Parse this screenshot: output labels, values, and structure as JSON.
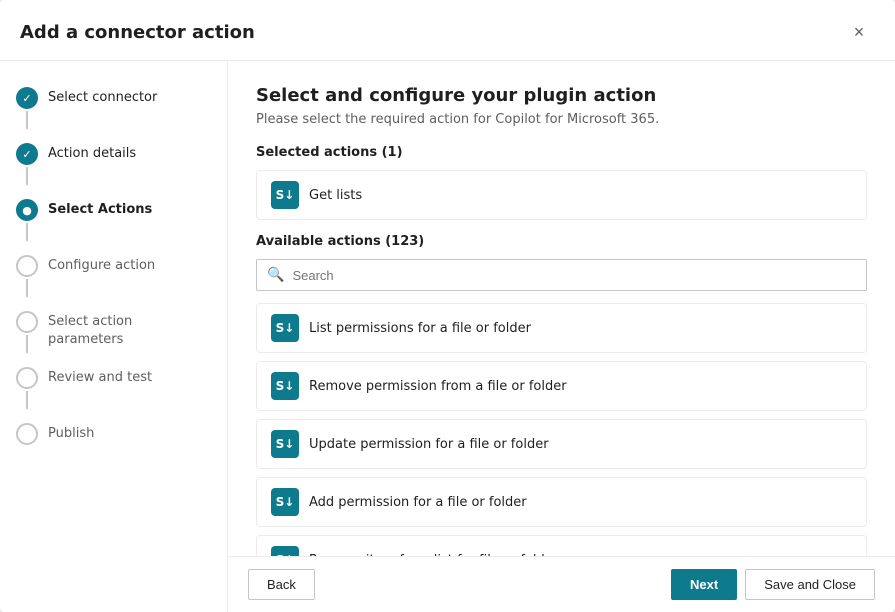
{
  "modal": {
    "title": "Add a connector action",
    "close_label": "×"
  },
  "sidebar": {
    "steps": [
      {
        "id": "select-connector",
        "label": "Select connector",
        "state": "completed"
      },
      {
        "id": "action-details",
        "label": "Action details",
        "state": "completed"
      },
      {
        "id": "select-actions",
        "label": "Select Actions",
        "state": "active"
      },
      {
        "id": "configure-action",
        "label": "Configure action",
        "state": "inactive"
      },
      {
        "id": "select-action-parameters",
        "label": "Select action parameters",
        "state": "inactive"
      },
      {
        "id": "review-and-test",
        "label": "Review and test",
        "state": "inactive"
      },
      {
        "id": "publish",
        "label": "Publish",
        "state": "inactive"
      }
    ]
  },
  "content": {
    "title": "Select and configure your plugin action",
    "subtitle": "Please select the required action for Copilot for Microsoft 365.",
    "selected_actions_label": "Selected actions (1)",
    "available_actions_label": "Available actions (123)",
    "search_placeholder": "Search",
    "selected_action": {
      "label": "Get lists",
      "icon": "S↓"
    },
    "available_actions": [
      {
        "label": "List permissions for a file or folder",
        "icon": "S↓"
      },
      {
        "label": "Remove permission from a file or folder",
        "icon": "S↓"
      },
      {
        "label": "Update permission for a file or folder",
        "icon": "S↓"
      },
      {
        "label": "Add permission for a file or folder",
        "icon": "S↓"
      },
      {
        "label": "Remove item from list for file or folder",
        "icon": "S↓"
      }
    ]
  },
  "footer": {
    "back_label": "Back",
    "next_label": "Next",
    "save_close_label": "Save and Close"
  }
}
